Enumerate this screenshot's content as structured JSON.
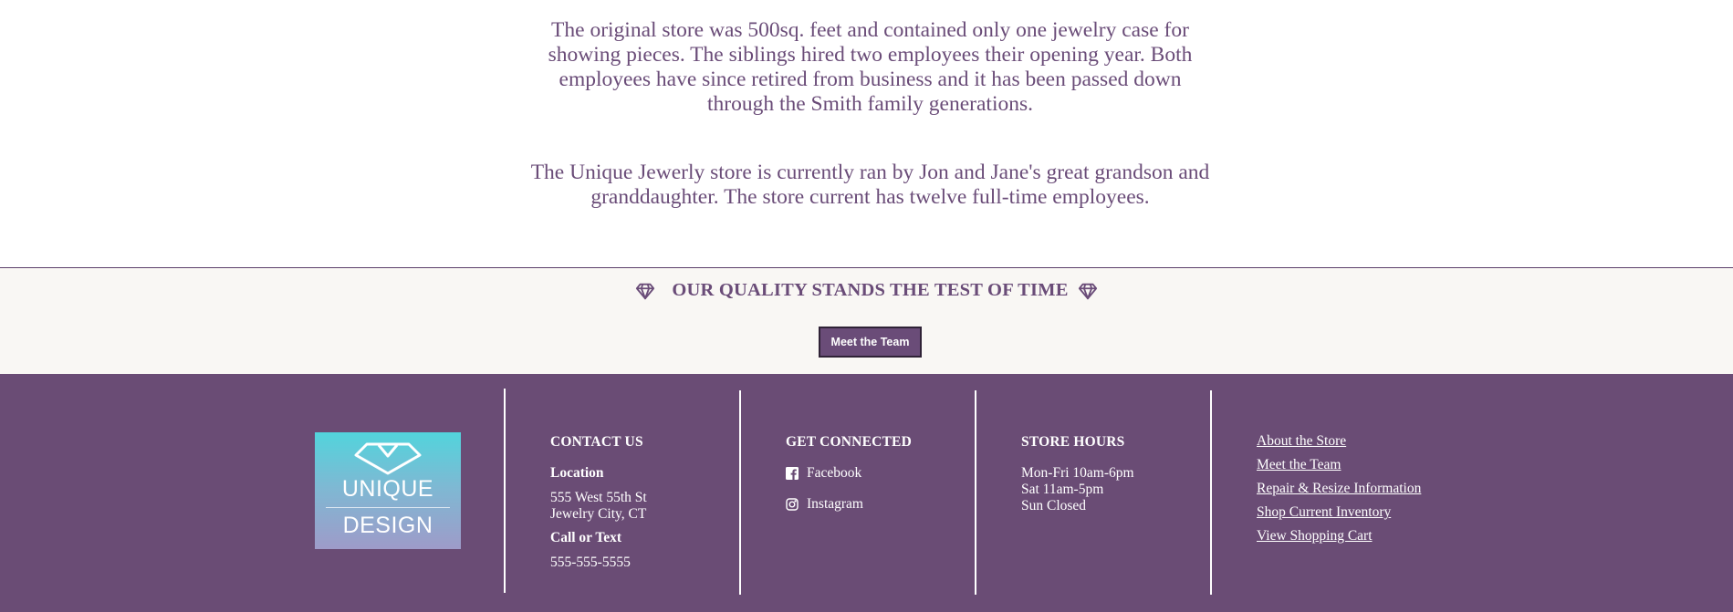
{
  "story": {
    "paragraph_1": "The original store was 500sq. feet and contained only one jewelry case for showing pieces. The siblings hired two employees their opening year. Both employees have since retired from business and it has been passed down through the Smith family generations.",
    "paragraph_2": "The Unique Jewerly store is currently ran by Jon and Jane's great grandson and granddaughter. The store current has twelve full-time employees."
  },
  "quality": {
    "tagline": "OUR QUALITY STANDS THE TEST OF TIME",
    "left_icon": "diamond-icon",
    "right_icon": "diamond-icon",
    "button_label": "Meet the Team"
  },
  "footer": {
    "logo": {
      "line1": "UNIQUE",
      "line2": "DESIGN"
    },
    "contact": {
      "heading": "CONTACT US",
      "location_label": "Location",
      "address_line1": "555 West 55th St",
      "address_line2": "Jewelry City, CT",
      "call_label": "Call or Text",
      "phone": "555-555-5555"
    },
    "connected": {
      "heading": "GET CONNECTED",
      "facebook": "Facebook",
      "instagram": "Instagram"
    },
    "hours": {
      "heading": "STORE HOURS",
      "line1": "Mon-Fri 10am-6pm",
      "line2": "Sat 11am-5pm",
      "line3": "Sun Closed"
    },
    "links": [
      "About the Store",
      "Meet the Team",
      "Repair & Resize Information",
      "Shop Current Inventory",
      "View Shopping Cart"
    ]
  },
  "colors": {
    "brand_purple": "#6a4c75",
    "text_purple": "#6a4c78",
    "quality_background": "#f9f7f4",
    "logo_gradient_top": "#52d4dc",
    "logo_gradient_bottom": "#9e9bc9"
  }
}
